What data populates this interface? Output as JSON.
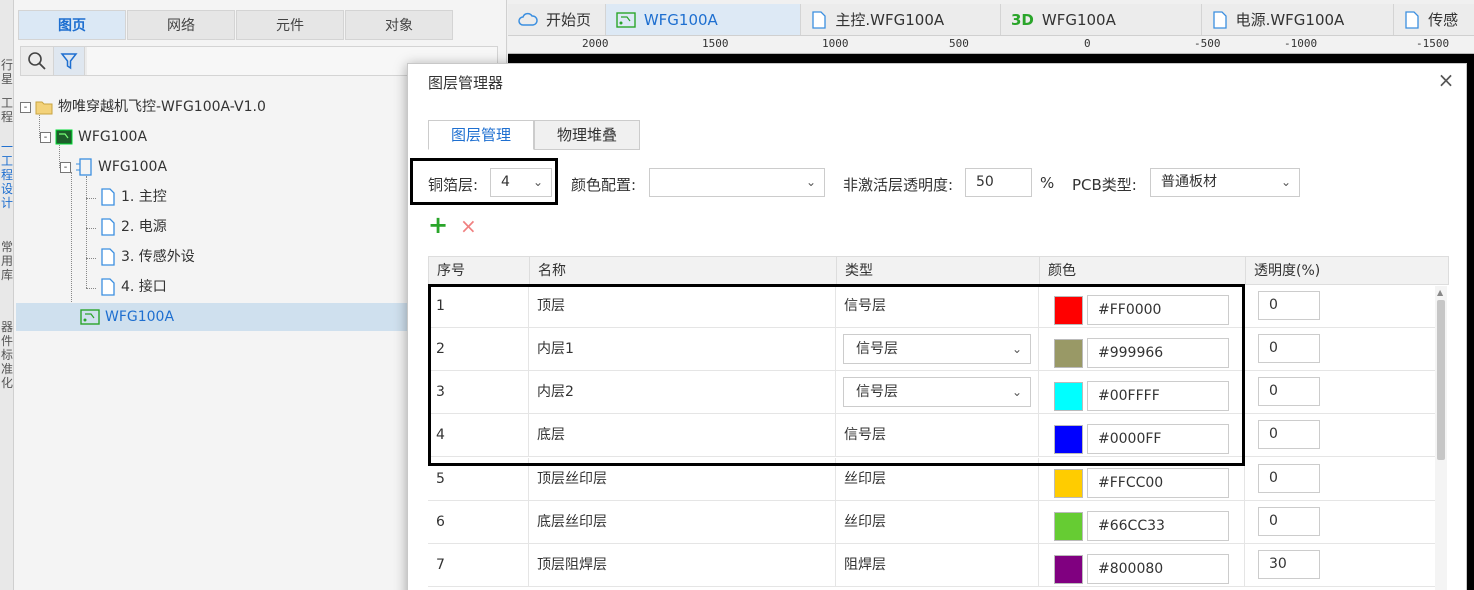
{
  "vstrip": [
    "行\n星",
    "工\n程",
    "一\n工\n程\n设\n计",
    "常\n用\n库",
    "器\n件\n标\n准\n化"
  ],
  "left_panel": {
    "tabs": [
      "图页",
      "网络",
      "元件",
      "对象"
    ],
    "active_tab": 0,
    "tree": [
      {
        "label": "物唯穿越机飞控-WFG100A-V1.0",
        "icon": "folder-icon",
        "toggle": "-"
      },
      {
        "label": "WFG100A",
        "icon": "pcb-board-icon",
        "toggle": "-"
      },
      {
        "label": "WFG100A",
        "icon": "schematic-icon",
        "toggle": "-"
      },
      {
        "label": "1. 主控",
        "icon": "page-icon"
      },
      {
        "label": "2. 电源",
        "icon": "page-icon"
      },
      {
        "label": "3. 传感外设",
        "icon": "page-icon"
      },
      {
        "label": "4. 接口",
        "icon": "page-icon"
      },
      {
        "label": "WFG100A",
        "icon": "pcb-icon",
        "selected": true
      }
    ]
  },
  "doc_tabs": [
    {
      "label": "开始页",
      "icon": "cloud-icon"
    },
    {
      "label": "WFG100A",
      "icon": "pcb-icon",
      "active": true
    },
    {
      "label": "主控.WFG100A",
      "icon": "page-icon"
    },
    {
      "label": "WFG100A",
      "icon": "3d-icon",
      "prefix": "3D"
    },
    {
      "label": "电源.WFG100A",
      "icon": "page-icon"
    },
    {
      "label": "传感",
      "icon": "page-icon"
    }
  ],
  "ruler": [
    "2000",
    "1500",
    "1000",
    "500",
    "0",
    "-500",
    "-1000",
    "-1500"
  ],
  "dialog": {
    "title": "图层管理器",
    "close": "×",
    "tabs": [
      "图层管理",
      "物理堆叠"
    ],
    "copper_label": "铜箔层:",
    "copper_value": "4",
    "color_config_label": "颜色配置:",
    "color_config_value": "",
    "inactive_opacity_label": "非激活层透明度:",
    "inactive_opacity_value": "50",
    "percent": "%",
    "pcb_type_label": "PCB类型:",
    "pcb_type_value": "普通板材",
    "add": "+",
    "delete": "×",
    "columns": [
      "序号",
      "名称",
      "类型",
      "颜色",
      "透明度(%)"
    ],
    "rows": [
      {
        "no": "1",
        "name": "顶层",
        "type": "信号层",
        "type_select": false,
        "color": "#FF0000",
        "opacity": "0"
      },
      {
        "no": "2",
        "name": "内层1",
        "type": "信号层",
        "type_select": true,
        "color": "#999966",
        "opacity": "0"
      },
      {
        "no": "3",
        "name": "内层2",
        "type": "信号层",
        "type_select": true,
        "color": "#00FFFF",
        "opacity": "0"
      },
      {
        "no": "4",
        "name": "底层",
        "type": "信号层",
        "type_select": false,
        "color": "#0000FF",
        "opacity": "0"
      },
      {
        "no": "5",
        "name": "顶层丝印层",
        "type": "丝印层",
        "type_select": false,
        "color": "#FFCC00",
        "opacity": "0"
      },
      {
        "no": "6",
        "name": "底层丝印层",
        "type": "丝印层",
        "type_select": false,
        "color": "#66CC33",
        "opacity": "0"
      },
      {
        "no": "7",
        "name": "顶层阻焊层",
        "type": "阻焊层",
        "type_select": false,
        "color": "#800080",
        "opacity": "30"
      }
    ]
  },
  "colors": {
    "accent": "#1e6fd0",
    "add": "#2aa52a",
    "delete": "#f08080"
  }
}
